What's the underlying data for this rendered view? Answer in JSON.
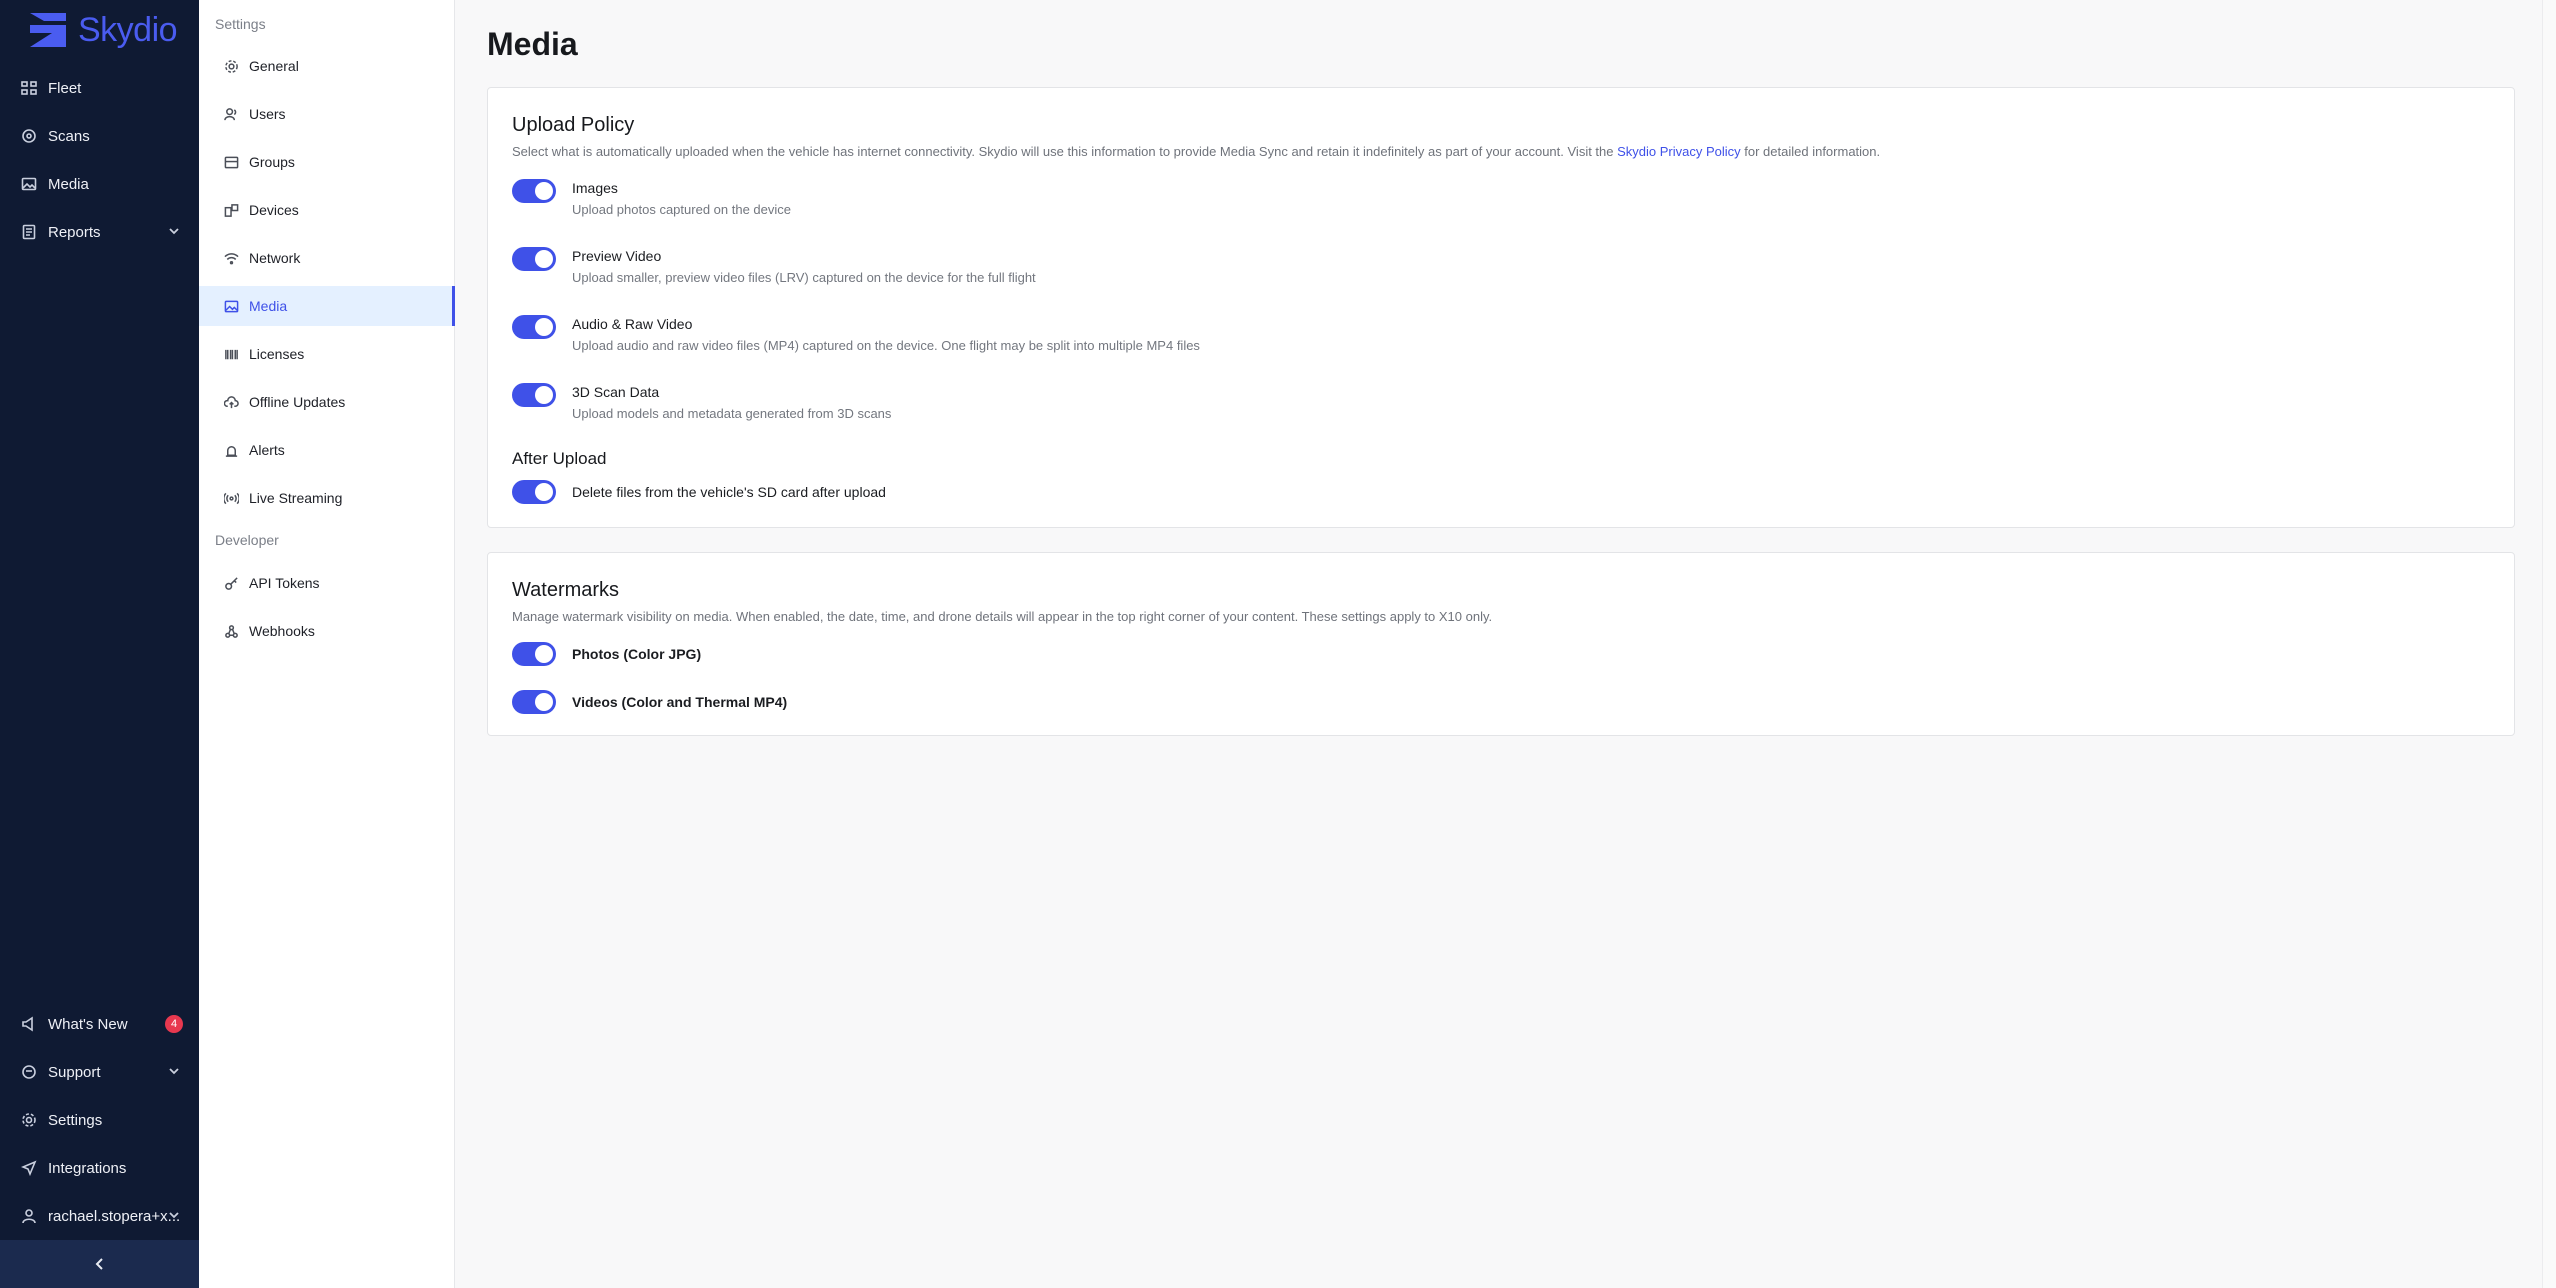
{
  "brand": {
    "name": "Skydio",
    "color": "#4a5cf0"
  },
  "nav": {
    "items": [
      {
        "label": "Fleet",
        "icon": "fleet-icon"
      },
      {
        "label": "Scans",
        "icon": "scans-icon"
      },
      {
        "label": "Media",
        "icon": "media-icon"
      },
      {
        "label": "Reports",
        "icon": "reports-icon",
        "expandable": true
      }
    ],
    "bottom": [
      {
        "label": "What's New",
        "icon": "megaphone-icon",
        "badge": "4"
      },
      {
        "label": "Support",
        "icon": "support-icon",
        "expandable": true
      },
      {
        "label": "Settings",
        "icon": "gear-icon"
      },
      {
        "label": "Integrations",
        "icon": "send-icon"
      },
      {
        "label": "rachael.stopera+x...",
        "icon": "user-icon",
        "expandable": true
      }
    ]
  },
  "sidebar": {
    "section_settings": "Settings",
    "items": [
      {
        "label": "General",
        "icon": "gear-icon"
      },
      {
        "label": "Users",
        "icon": "users-icon"
      },
      {
        "label": "Groups",
        "icon": "groups-icon"
      },
      {
        "label": "Devices",
        "icon": "devices-icon"
      },
      {
        "label": "Network",
        "icon": "wifi-icon"
      },
      {
        "label": "Media",
        "icon": "media-icon",
        "active": true
      },
      {
        "label": "Licenses",
        "icon": "barcode-icon"
      },
      {
        "label": "Offline Updates",
        "icon": "cloud-upload-icon"
      },
      {
        "label": "Alerts",
        "icon": "alarm-icon"
      },
      {
        "label": "Live Streaming",
        "icon": "broadcast-icon"
      }
    ],
    "section_developer": "Developer",
    "dev_items": [
      {
        "label": "API Tokens",
        "icon": "key-icon"
      },
      {
        "label": "Webhooks",
        "icon": "webhook-icon"
      }
    ]
  },
  "page": {
    "title": "Media"
  },
  "upload_policy": {
    "title": "Upload Policy",
    "desc_before": "Select what is automatically uploaded when the vehicle has internet connectivity. Skydio will use this information to provide Media Sync and retain it indefinitely as part of your account. Visit the ",
    "link": "Skydio Privacy Policy",
    "desc_after": " for detailed information.",
    "toggles": [
      {
        "label": "Images",
        "desc": "Upload photos captured on the device",
        "on": true
      },
      {
        "label": "Preview Video",
        "desc": "Upload smaller, preview video files (LRV) captured on the device for the full flight",
        "on": true
      },
      {
        "label": "Audio & Raw Video",
        "desc": "Upload audio and raw video files (MP4) captured on the device. One flight may be split into multiple MP4 files",
        "on": true
      },
      {
        "label": "3D Scan Data",
        "desc": "Upload models and metadata generated from 3D scans",
        "on": true
      }
    ],
    "after_upload_title": "After Upload",
    "after_upload_label": "Delete files from the vehicle's SD card after upload"
  },
  "watermarks": {
    "title": "Watermarks",
    "desc": "Manage watermark visibility on media. When enabled, the date, time, and drone details will appear in the top right corner of your content. These settings apply to X10 only.",
    "toggles": [
      {
        "label": "Photos (Color JPG)",
        "on": true
      },
      {
        "label": "Videos (Color and Thermal MP4)",
        "on": true
      }
    ]
  }
}
